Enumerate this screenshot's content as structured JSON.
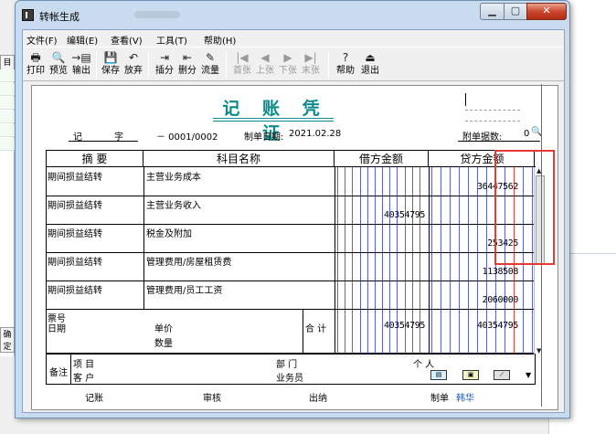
{
  "window": {
    "title": "转帐生成"
  },
  "background": {
    "left_tag_top": "目目",
    "left_tag_bottom": "确定"
  },
  "menu": [
    "文件(F)",
    "编辑(E)",
    "查看(V)",
    "工具(T)",
    "帮助(H)"
  ],
  "toolbar": [
    {
      "label": "打印",
      "icon": "printer-icon",
      "glyph": "🖶",
      "enabled": true
    },
    {
      "label": "预览",
      "icon": "preview-icon",
      "glyph": "🔍",
      "enabled": true
    },
    {
      "label": "输出",
      "icon": "export-icon",
      "glyph": "→▤",
      "enabled": true
    },
    {
      "label": "保存",
      "icon": "save-icon",
      "glyph": "💾",
      "enabled": true
    },
    {
      "label": "放弃",
      "icon": "undo-icon",
      "glyph": "↶",
      "enabled": true
    },
    {
      "label": "插分",
      "icon": "insert-row-icon",
      "glyph": "⇥",
      "enabled": true
    },
    {
      "label": "删分",
      "icon": "delete-row-icon",
      "glyph": "⇤",
      "enabled": true
    },
    {
      "label": "流量",
      "icon": "flow-icon",
      "glyph": "✎",
      "enabled": true
    },
    {
      "label": "首张",
      "icon": "first-icon",
      "glyph": "|◀",
      "enabled": false
    },
    {
      "label": "上张",
      "icon": "prev-icon",
      "glyph": "◀",
      "enabled": false
    },
    {
      "label": "下张",
      "icon": "next-icon",
      "glyph": "▶",
      "enabled": false
    },
    {
      "label": "末张",
      "icon": "last-icon",
      "glyph": "▶|",
      "enabled": false
    },
    {
      "label": "帮助",
      "icon": "help-icon",
      "glyph": "?",
      "enabled": true
    },
    {
      "label": "退出",
      "icon": "exit-icon",
      "glyph": "⏏",
      "enabled": true
    }
  ],
  "voucher": {
    "title": "记 账 凭 证",
    "type_label": "记",
    "word_label": "字",
    "number": "－ 0001/0002",
    "date_label": "制单日期:",
    "date": "2021.02.28",
    "attach_label": "附单据数:",
    "attach_count": "0",
    "headers": {
      "summary": "摘 要",
      "account": "科目名称",
      "debit": "借方金额",
      "credit": "贷方金额"
    },
    "rows": [
      {
        "summary": "期间损益结转",
        "account": "主营业务成本",
        "debit": "",
        "credit": "36447562"
      },
      {
        "summary": "期间损益结转",
        "account": "主营业务收入",
        "debit": "40354795",
        "credit": ""
      },
      {
        "summary": "期间损益结转",
        "account": "税金及附加",
        "debit": "",
        "credit": "253425"
      },
      {
        "summary": "期间损益结转",
        "account": "管理费用/房屋租赁费",
        "debit": "",
        "credit": "1138508"
      },
      {
        "summary": "期间损益结转",
        "account": "管理费用/员工工资",
        "debit": "",
        "credit": "2060000"
      }
    ],
    "bottom": {
      "ticket_label": "票号",
      "date_label": "日期",
      "price_label": "单价",
      "qty_label": "数量",
      "total_label": "合 计",
      "total_debit": "40354795",
      "total_credit": "40354795"
    },
    "remarks": {
      "label": "备注",
      "project": "项 目",
      "customer": "客 户",
      "department": "部 门",
      "salesman": "业务员",
      "person": "个 人"
    },
    "footer": {
      "bookkeeping": "记账",
      "audit": "审核",
      "cashier": "出纳",
      "maker_label": "制单",
      "maker": "韩华"
    }
  }
}
